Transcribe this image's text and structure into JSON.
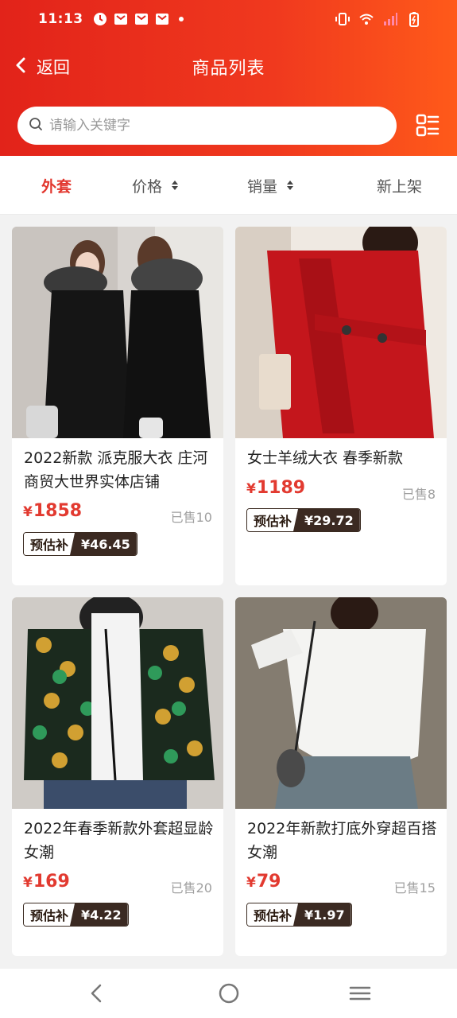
{
  "status_bar": {
    "time": "11:13",
    "left_icons": [
      "app-notification-icon",
      "mail-icon",
      "mail-icon",
      "mail-icon",
      "dot-icon"
    ],
    "right_icons": [
      "vibrate-icon",
      "wifi-icon",
      "signal-icon",
      "battery-charging-icon"
    ]
  },
  "nav": {
    "back_label": "返回",
    "title": "商品列表"
  },
  "search": {
    "placeholder": "请输入关键字",
    "value": ""
  },
  "tabs": [
    {
      "label": "外套",
      "active": true
    },
    {
      "label": "价格",
      "sortable": true
    },
    {
      "label": "销量",
      "sortable": true
    },
    {
      "label": "新上架"
    }
  ],
  "products": [
    {
      "title": "2022新款 派克服大衣 庄河商贸大世界实体店铺",
      "currency": "¥",
      "price": "1858",
      "sold": "已售10",
      "subsidy_label": "预估补",
      "subsidy_value": "¥46.45"
    },
    {
      "title": "女士羊绒大衣 春季新款",
      "currency": "¥",
      "price": "1189",
      "sold": "已售8",
      "subsidy_label": "预估补",
      "subsidy_value": "¥29.72"
    },
    {
      "title": "2022年春季新款外套超显龄女潮",
      "currency": "¥",
      "price": "169",
      "sold": "已售20",
      "subsidy_label": "预估补",
      "subsidy_value": "¥4.22"
    },
    {
      "title": "2022年新款打底外穿超百搭女潮",
      "currency": "¥",
      "price": "79",
      "sold": "已售15",
      "subsidy_label": "预估补",
      "subsidy_value": "¥1.97"
    }
  ],
  "colors": {
    "header_start": "#e2231a",
    "header_end": "#ff5a1a",
    "accent_red": "#e23a30",
    "subsidy_dark": "#3b2a22"
  }
}
